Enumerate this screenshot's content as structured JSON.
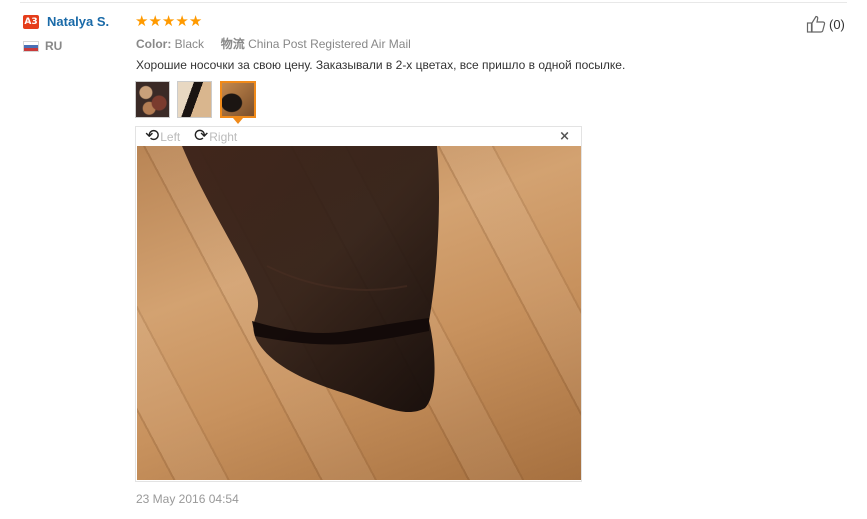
{
  "review": {
    "user_badge": "A3",
    "user_name": "Natalya S.",
    "country": "RU",
    "rating": 5,
    "stars": [
      "★",
      "★",
      "★",
      "★",
      "★"
    ],
    "color_label": "Color:",
    "color_value": "Black",
    "shipping_label": "物流",
    "shipping_value": "China Post Registered Air Mail",
    "text": "Хорошие носочки за свою цену. Заказывали в 2-х цветах, все пришло в одной посылке.",
    "helpful_count": "(0)",
    "date": "23 May 2016 04:54"
  },
  "viewer": {
    "rotate_left_label": "Left",
    "rotate_right_label": "Right",
    "close_glyph": "×",
    "rotate_left_glyph": "⟲",
    "rotate_right_glyph": "⟳",
    "selected_thumbnail": 3
  },
  "icons": {
    "like": "thumbs-up-icon",
    "flag": "russia-flag-icon",
    "badge": "level-badge-icon"
  },
  "colors": {
    "user_name": "#1a6aa8",
    "star": "#ff9a00",
    "badge": "#e53d1a",
    "selected_border": "#f08a1a"
  }
}
